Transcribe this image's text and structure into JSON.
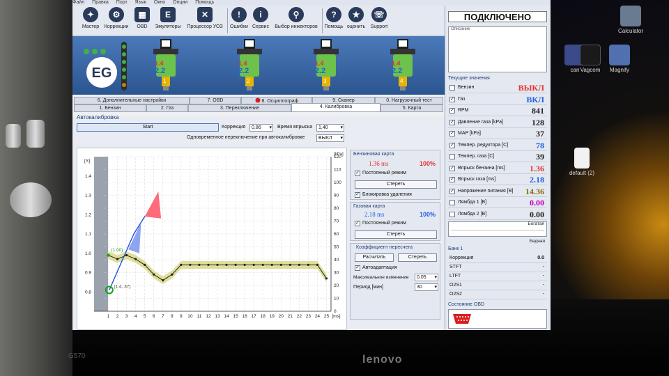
{
  "colors": {
    "accent": "#2b5590",
    "petrol": "#e63232",
    "gas": "#2060e0",
    "value": "#222222",
    "mix_rich": "#c000c0"
  },
  "menu": [
    "Файл",
    "Правка",
    "Порт",
    "Язык",
    "Окно",
    "Опции",
    "Помощь"
  ],
  "toolbar": [
    {
      "label": "Мастер",
      "icon": "wand-icon"
    },
    {
      "label": "Коррекции",
      "icon": "gear-icon"
    },
    {
      "label": "OBD",
      "icon": "keyboard-icon"
    },
    {
      "label": "Эмуляторы",
      "icon": "e-letter-icon"
    },
    {
      "label": "Процессор УОЗ",
      "icon": "tools-icon"
    },
    {
      "label": "Ошибки",
      "icon": "warning-icon"
    },
    {
      "label": "Сервис",
      "icon": "info-icon"
    },
    {
      "label": "Выбор инжекторов",
      "icon": "injector-icon"
    },
    {
      "label": "Помощь",
      "icon": "question-icon"
    },
    {
      "label": "оценить",
      "icon": "star-icon"
    },
    {
      "label": "Support",
      "icon": "support-icon"
    }
  ],
  "injectors": [
    {
      "number": "1",
      "petrol": "1.4",
      "gas": "2.2"
    },
    {
      "number": "2",
      "petrol": "1.4",
      "gas": "2.2"
    },
    {
      "number": "3",
      "petrol": "1.4",
      "gas": "2.2"
    },
    {
      "number": "4",
      "petrol": "1.4",
      "gas": "2.2"
    }
  ],
  "tabs_back": [
    "6. Дополнительные настройки",
    "7. OBD",
    "8. Осциллограф",
    "9. Сканер",
    "0. Нагрузочный тест"
  ],
  "tabs_front": [
    "1. Бензин",
    "2. Газ",
    "3. Переключение",
    "4. Калибровка",
    "5. Карта"
  ],
  "active_tab": "4. Калибровка",
  "calibration": {
    "title": "Автокалибровка",
    "start_label": "Start",
    "correction_label": "Коррекция",
    "correction_value": "0,86",
    "inj_time_label": "Время впрыска",
    "inj_time_value": "1,40",
    "switch_label": "Одновременное переключение при автокалибровке",
    "switch_value": "ВЫКЛ"
  },
  "petrol_map": {
    "title": "Бензиновая карта",
    "time": "1.36 ms",
    "percent": "100%",
    "permanent_label": "Постоянный режим",
    "clear_label": "Стереть",
    "lock_label": "Блокировка удаления"
  },
  "gas_map": {
    "title": "Газовая карта",
    "time": "2.18 ms",
    "percent": "100%",
    "permanent_label": "Постоянный режим",
    "clear_label": "Стереть"
  },
  "recalc": {
    "title": "Коэффициент пересчета",
    "calc_label": "Расчитать",
    "clear_label": "Стереть",
    "auto_label": "Автоадаптация",
    "max_change_label": "Максимальное изменение",
    "max_change_value": "0,05",
    "period_label": "Период [мин]",
    "period_value": "30"
  },
  "status": "ПОДКЛЮЧЕНО",
  "notes_title": "Описание",
  "current_title": "Текущие значения",
  "current_values": [
    {
      "name": "Бензин",
      "value": "ВЫКЛ",
      "checked": false,
      "color": "#e63232"
    },
    {
      "name": "Газ",
      "value": "ВКЛ",
      "checked": true,
      "color": "#2060e0"
    },
    {
      "name": "RPM",
      "value": "841",
      "checked": true,
      "color": "#222222"
    },
    {
      "name": "Давление газа [kPa]",
      "value": "128",
      "checked": true,
      "color": "#222222"
    },
    {
      "name": "MAP [kPa]",
      "value": "37",
      "checked": true,
      "color": "#222222"
    },
    {
      "name": "Темпер. редуктора [C]",
      "value": "78",
      "checked": true,
      "color": "#2060e0"
    },
    {
      "name": "Темпер. газа [C]",
      "value": "39",
      "checked": false,
      "color": "#222222"
    },
    {
      "name": "Впрыск бензина [ms]",
      "value": "1.36",
      "checked": true,
      "color": "#e63232"
    },
    {
      "name": "Впрыск газа [ms]",
      "value": "2.18",
      "checked": true,
      "color": "#2060e0"
    },
    {
      "name": "Напряжение питания [В]",
      "value": "14.36",
      "checked": true,
      "color": "#8a6a00"
    },
    {
      "name": "Лямбда 1 [В]",
      "value": "0.00",
      "checked": false,
      "color": "#c000c0"
    },
    {
      "name": "Лямбда 2 [В]",
      "value": "0.00",
      "checked": false,
      "color": "#222222"
    }
  ],
  "mixture": {
    "rich_label": "Богатая",
    "lean_label": "Бедная"
  },
  "bank": {
    "title": "Банк 1",
    "rows": [
      {
        "name": "Коррекция",
        "value": "0.0"
      },
      {
        "name": "STFT",
        "value": "-"
      },
      {
        "name": "LTFT",
        "value": "-"
      },
      {
        "name": "O2S1",
        "value": "-"
      },
      {
        "name": "O2S2",
        "value": "-"
      }
    ]
  },
  "obd_title": "Состояние OBD",
  "desktop": {
    "icons": [
      {
        "label": "Calculator",
        "icon": "calculator-icon"
      },
      {
        "label": "can",
        "icon": "can-icon"
      },
      {
        "label": "Vagcom",
        "icon": "vagcom-icon"
      },
      {
        "label": "Magnify",
        "icon": "magnify-icon"
      },
      {
        "label": "default (2)",
        "icon": "pdf-file-icon"
      }
    ]
  },
  "laptop": {
    "brand": "lenovo",
    "model": "G570"
  },
  "chart_data": {
    "type": "line",
    "x_ticks": [
      1,
      2,
      3,
      4,
      5,
      6,
      7,
      8,
      9,
      10,
      11,
      12,
      13,
      14,
      15,
      16,
      17,
      18,
      19,
      20,
      21,
      22,
      23,
      24,
      25
    ],
    "x_unit": "[ms]",
    "left_axis": {
      "label": "[X]",
      "ylim": [
        0.7,
        1.5
      ],
      "ticks": [
        0.8,
        0.9,
        1.0,
        1.1,
        1.2,
        1.3,
        1.4
      ]
    },
    "right_axis": {
      "label": "[kPa]",
      "ylim": [
        0,
        120
      ],
      "ticks": [
        0,
        10,
        20,
        30,
        40,
        50,
        60,
        70,
        80,
        90,
        100,
        110,
        120
      ]
    },
    "annotations": [
      "(1.00)",
      "(1.4, 37)"
    ],
    "series": [
      {
        "x": [
          1,
          2,
          3,
          4,
          5,
          6,
          7,
          8,
          9,
          10,
          11,
          12,
          13,
          14,
          15,
          16,
          17,
          18,
          19,
          20,
          21,
          22,
          23,
          24,
          25
        ],
        "y": [
          0.99,
          0.97,
          0.99,
          0.97,
          0.94,
          0.89,
          0.86,
          0.89,
          0.94,
          0.94,
          0.94,
          0.94,
          0.94,
          0.94,
          0.94,
          0.94,
          0.94,
          0.94,
          0.94,
          0.94,
          0.94,
          0.94,
          0.94,
          0.94,
          0.87
        ]
      }
    ],
    "band_halfwidth": 0.02,
    "petrol_trace": {
      "x": [
        1.1,
        2.4,
        3.8,
        5.0,
        6.5
      ],
      "y": [
        0.81,
        0.95,
        1.1,
        1.19,
        1.24
      ]
    }
  }
}
